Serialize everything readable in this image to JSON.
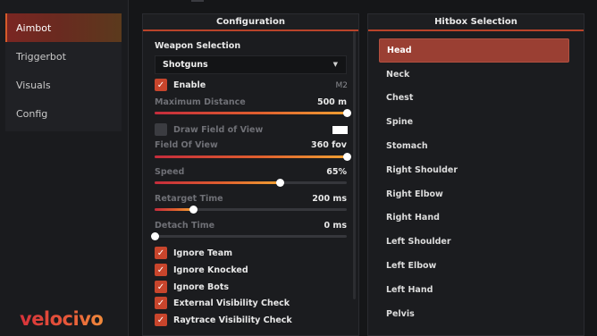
{
  "sidebar": {
    "items": [
      {
        "label": "Aimbot",
        "active": true
      },
      {
        "label": "Triggerbot",
        "active": false
      },
      {
        "label": "Visuals",
        "active": false
      },
      {
        "label": "Config",
        "active": false
      }
    ],
    "logo": "velocivo"
  },
  "config": {
    "title": "Configuration",
    "weapon_selection_label": "Weapon Selection",
    "weapon_selected": "Shotguns",
    "enable": {
      "label": "Enable",
      "checked": true,
      "keybind": "M2"
    },
    "max_distance": {
      "label": "Maximum Distance",
      "value": "500 m",
      "fraction": 1.0
    },
    "draw_fov": {
      "label": "Draw Field of View",
      "checked": false,
      "color": "#ffffff"
    },
    "fov": {
      "label": "Field Of View",
      "value": "360 fov",
      "fraction": 1.0
    },
    "speed": {
      "label": "Speed",
      "value": "65%",
      "fraction": 0.65
    },
    "retarget_time": {
      "label": "Retarget Time",
      "value": "200 ms",
      "fraction": 0.2
    },
    "detach_time": {
      "label": "Detach Time",
      "value": "0 ms",
      "fraction": 0.0
    },
    "checks": [
      {
        "label": "Ignore Team",
        "checked": true
      },
      {
        "label": "Ignore Knocked",
        "checked": true
      },
      {
        "label": "Ignore Bots",
        "checked": true
      },
      {
        "label": "External Visibility Check",
        "checked": true
      },
      {
        "label": "Raytrace Visibility Check",
        "checked": true
      }
    ]
  },
  "hitbox": {
    "title": "Hitbox Selection",
    "items": [
      "Head",
      "Neck",
      "Chest",
      "Spine",
      "Stomach",
      "Right Shoulder",
      "Right Elbow",
      "Right Hand",
      "Left Shoulder",
      "Left Elbow",
      "Left Hand",
      "Pelvis"
    ],
    "selected": "Head"
  },
  "colors": {
    "accent": "#c8452c",
    "selected_row": "#9a3f33",
    "background": "#151618"
  }
}
